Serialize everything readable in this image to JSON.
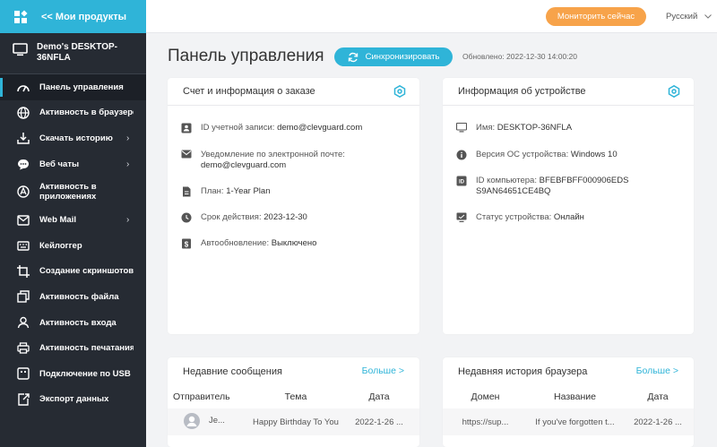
{
  "sidebar": {
    "back_label": "<< Мои продукты",
    "device_name": "Demo's DESKTOP-36NFLA",
    "items": [
      {
        "label": "Панель управления",
        "icon": "dashboard-icon",
        "active": true
      },
      {
        "label": "Активность в браузере",
        "icon": "globe-icon"
      },
      {
        "label": "Скачать историю",
        "icon": "download-icon",
        "arrow": true
      },
      {
        "label": "Веб чаты",
        "icon": "chat-icon",
        "arrow": true
      },
      {
        "label": "Активность в приложениях",
        "icon": "app-icon"
      },
      {
        "label": "Web Mail",
        "icon": "mail-icon",
        "arrow": true
      },
      {
        "label": "Кейлоггер",
        "icon": "keyboard-icon"
      },
      {
        "label": "Создание скриншотов",
        "icon": "crop-icon"
      },
      {
        "label": "Активность файла",
        "icon": "file-icon"
      },
      {
        "label": "Активность входа",
        "icon": "user-icon"
      },
      {
        "label": "Активность печатания",
        "icon": "printer-icon"
      },
      {
        "label": "Подключение по USB",
        "icon": "usb-icon"
      },
      {
        "label": "Экспорт данных",
        "icon": "export-icon"
      }
    ]
  },
  "topbar": {
    "monitor_label": "Мониторить сейчас",
    "language": "Русский"
  },
  "header": {
    "title": "Панель управления",
    "sync_label": "Синхронизировать",
    "updated": "Обновлено: 2022-12-30 14:00:20"
  },
  "account": {
    "title": "Счет и информация о заказе",
    "id_label": "ID учетной записи:",
    "id_value": "demo@clevguard.com",
    "email_label": "Уведомление по электронной почте:",
    "email_value": "demo@clevguard.com",
    "plan_label": "План:",
    "plan_value": "1-Year Plan",
    "expiry_label": "Срок действия:",
    "expiry_value": "2023-12-30",
    "autorenew_label": "Автообновление:",
    "autorenew_value": "Выключено"
  },
  "device": {
    "title": "Информация об устройстве",
    "name_label": "Имя:",
    "name_value": "DESKTOP-36NFLA",
    "os_label": "Версия ОС устройства:",
    "os_value": "Windows 10",
    "pcid_label": "ID компьютера:",
    "pcid_value": "BFEBFBFF000906EDS9AN64651CE4BQ",
    "pcid_line1": "BFEBFBFF000906EDS",
    "pcid_line2": "S9AN64651CE4BQ",
    "status_label": "Статус устройства:",
    "status_value": "Онлайн"
  },
  "messages": {
    "title": "Недавние сообщения",
    "more": "Больше >",
    "columns": [
      "Отправитель",
      "Тема",
      "Дата"
    ],
    "rows": [
      {
        "sender": "Je...",
        "subject": "Happy Birthday To You",
        "date": "2022-1-26 ..."
      }
    ]
  },
  "browser": {
    "title": "Недавняя история браузера",
    "more": "Больше >",
    "columns": [
      "Домен",
      "Название",
      "Дата"
    ],
    "rows": [
      {
        "domain": "https://sup...",
        "name": "If you've forgotten t...",
        "date": "2022-1-26 ..."
      }
    ]
  },
  "colors": {
    "accent": "#2fb4d8",
    "orange": "#f7a34a",
    "sidebar": "#262b33"
  }
}
